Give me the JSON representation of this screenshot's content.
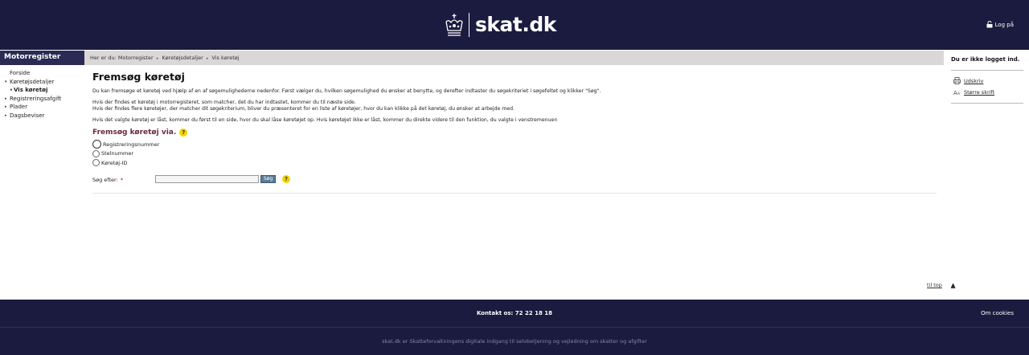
{
  "header": {
    "logo_text": "skat.dk",
    "login_label": "Log på"
  },
  "left_nav": {
    "title": "Motorregister",
    "items": [
      {
        "label": "Forside",
        "marker": ""
      },
      {
        "label": "Køretøjsdetaljer",
        "marker": "▾"
      },
      {
        "label": "Vis køretøj",
        "marker": "•"
      },
      {
        "label": "Registreringsafgift",
        "marker": "▸"
      },
      {
        "label": "Plader",
        "marker": "▸"
      },
      {
        "label": "Dagsbeviser",
        "marker": "▸"
      }
    ]
  },
  "breadcrumb": {
    "prefix": "Her er du:",
    "items": [
      "Motorregister",
      "Køretøjsdetaljer",
      "Vis køretøj"
    ],
    "separator": "▸"
  },
  "main": {
    "title": "Fremsøg køretøj",
    "paragraph1": "Du kan fremsøge et køretøj ved hjælp af en af søgemulighederne nedenfor. Først vælger du, hvilken søgemulighed du ønsker at benytte, og derefter indtaster du søgekriteriet i søgefeltet og klikker \"Søg\".",
    "paragraph2_line1": "Hvis der findes et køretøj i motorregisteret, som matcher, det du har indtastet, kommer du til næste side.",
    "paragraph2_line2": "Hvis der findes flere køretøjer, der matcher dit søgekriterium, bliver du præsenteret for en liste af køretøjer, hvor du kan klikke på det køretøj, du ønsker at arbejde med.",
    "paragraph3": "Hvis det valgte køretøj er låst, kommer du først til en side, hvor du skal låse køretøjet op. Hvis køretøjet ikke er låst, kommer du direkte videre til den funktion, du valgte i venstremenuen",
    "search_via_title": "Fremsøg køretøj via.",
    "help_glyph": "?",
    "radio_options": [
      "Registreringsnummer",
      "Stelnummer",
      "Køretøj-ID"
    ],
    "search_label": "Søg efter:",
    "required_mark": "*",
    "search_value": "",
    "search_button": "Søg"
  },
  "right_panel": {
    "status": "Du er ikke logget ind.",
    "links": [
      "Udskriv",
      "Større skrift"
    ]
  },
  "to_top": {
    "label": "til top",
    "arrow": "▲"
  },
  "footer": {
    "contact": "Kontakt os:  72 22 18 18",
    "cookies": "Om cookies",
    "tagline": "skat.dk er Skatteforvaltningens digitale indgang til selvbetjening og vejledning om skatter og afgifter"
  },
  "colors": {
    "header_bg": "#1b1a3f",
    "section_title": "#6b2a45",
    "help_icon": "#f2d400"
  }
}
